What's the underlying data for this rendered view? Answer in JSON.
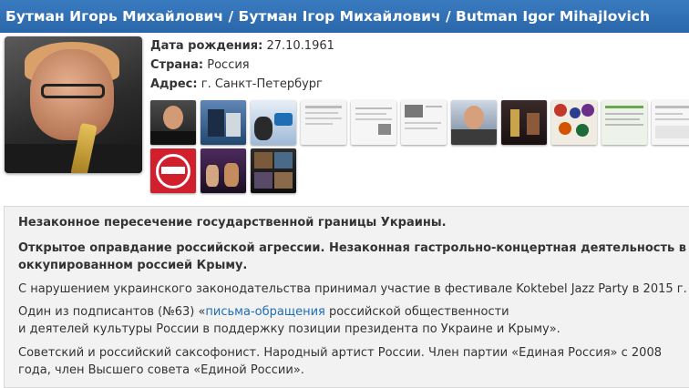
{
  "header": {
    "title": "Бутман Игорь Михайлович / Бутман Ігор Михайлович / Butman Igor Mihajlovich"
  },
  "profile": {
    "birth_label": "Дата рождения:",
    "birth_value": "27.10.1961",
    "country_label": "Страна:",
    "country_value": "Россия",
    "address_label": "Адрес:",
    "address_value": "г. Санкт-Петербург"
  },
  "thumbnails": [
    {
      "name": "thumb-photo-1"
    },
    {
      "name": "thumb-photo-2"
    },
    {
      "name": "thumb-photo-3"
    },
    {
      "name": "thumb-doc-1"
    },
    {
      "name": "thumb-doc-2"
    },
    {
      "name": "thumb-doc-3"
    },
    {
      "name": "thumb-photo-4"
    },
    {
      "name": "thumb-photo-5"
    },
    {
      "name": "thumb-collage"
    },
    {
      "name": "thumb-doc-4"
    },
    {
      "name": "thumb-doc-5"
    },
    {
      "name": "thumb-poster"
    },
    {
      "name": "thumb-photo-6"
    },
    {
      "name": "thumb-photo-7"
    }
  ],
  "notes": {
    "p1": "Незаконное пересечение государственной границы Украины.",
    "p2_line1": "Открытое оправдание российской агрессии. Незаконная гастрольно-концертная деятельность в",
    "p2_line2": "оккупированном россией Крыму.",
    "p3": "С нарушением украинского законодательства принимал участие в фестивале Koktebel Jazz Party в 2015 г.",
    "p4_before": "Один из подписантов (№63) «",
    "p4_link": "письма-обращения",
    "p4_after": " российской общественности",
    "p4_line2": "и деятелей культуры России в поддержку позиции президента по Украине и Крыму».",
    "p5_line1": "Советский и российский саксофонист. Народный артист России. Член партии «Единая Россия» с 2008",
    "p5_line2": "года, член Высшего совета «Единой России»."
  }
}
